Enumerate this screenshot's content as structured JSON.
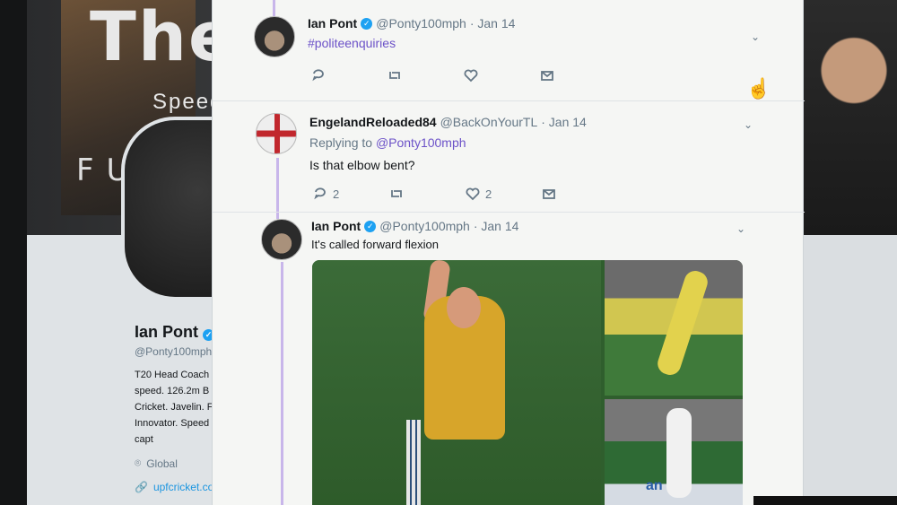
{
  "banner": {
    "title": "The F",
    "subtitle": "Speed &",
    "future": "FUT"
  },
  "profile": {
    "name": "Ian Pont",
    "handle": "@Ponty100mph",
    "bio": "T20 Head Coach\nspeed. 126.2m B\nCricket. Javelin. F\nInnovator. Speed\ncapt",
    "location": "Global",
    "link": "upfcricket.co"
  },
  "tweets": [
    {
      "name": "Ian Pont",
      "handle": "@Ponty100mph",
      "date": "· Jan 14",
      "text": "#politeenquiries"
    },
    {
      "name": "EngelandReloaded84",
      "handle": "@BackOnYourTL",
      "date": "· Jan 14",
      "replying_label": "Replying to ",
      "replying_to": "@Ponty100mph",
      "text": "Is that elbow bent?",
      "replies": "2",
      "likes": "2"
    },
    {
      "name": "Ian Pont",
      "handle": "@Ponty100mph",
      "date": "· Jan 14",
      "text": "It's called forward flexion"
    }
  ],
  "media": {
    "sponsor": "an"
  },
  "icons": {
    "verified": "verified-badge-icon",
    "reply": "reply-icon",
    "retweet": "retweet-icon",
    "like": "heart-icon",
    "dm": "mail-icon",
    "caret": "chevron-down-icon"
  },
  "colors": {
    "accent": "#6c52c8",
    "verified": "#1da1f2",
    "thread": "#c8b6ea"
  }
}
